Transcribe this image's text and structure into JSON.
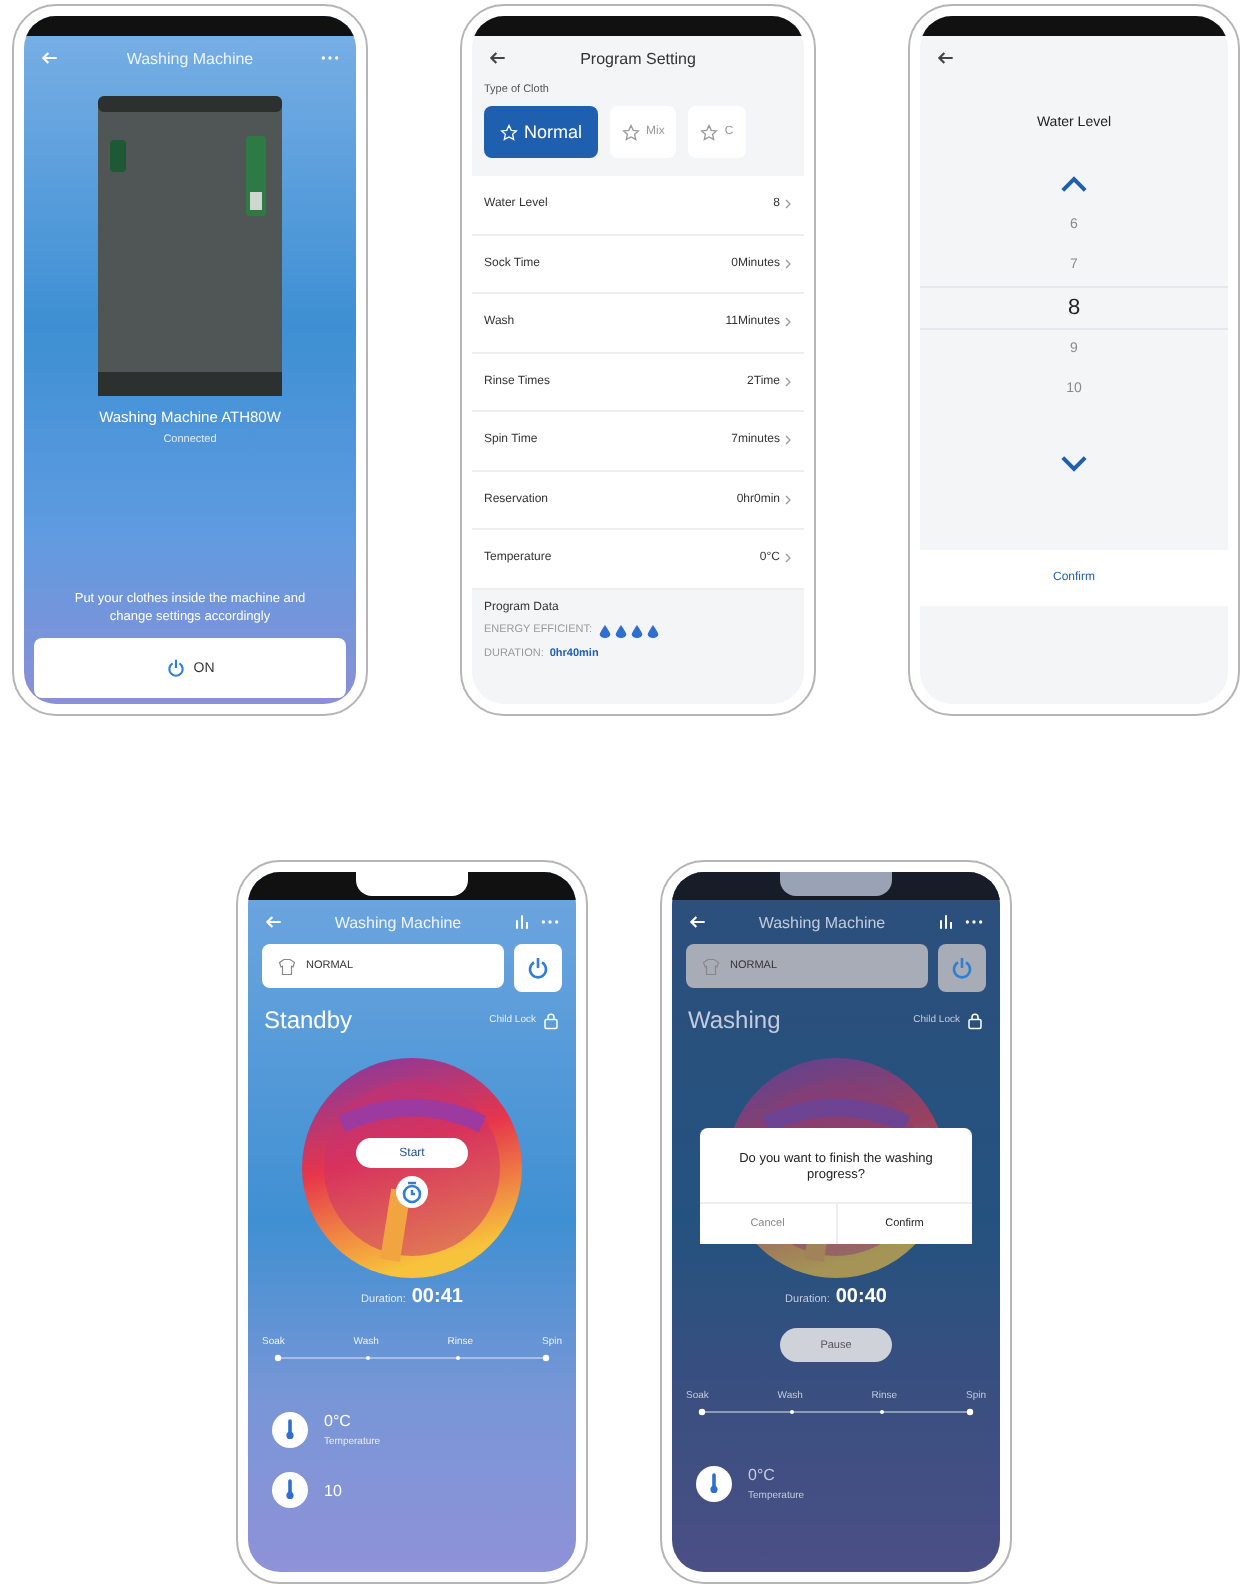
{
  "device_screen": {
    "title": "Washing Machine",
    "model": "Washing Machine ATH80W",
    "status": "Connected",
    "hint": "Put your clothes inside the machine and change settings accordingly",
    "power_button": "ON"
  },
  "program_screen": {
    "title": "Program Setting",
    "cloth_label": "Type of Cloth",
    "cloth_types": [
      {
        "label": "Normal",
        "selected": true
      },
      {
        "label": "Mix",
        "selected": false
      },
      {
        "label": "C",
        "selected": false
      }
    ],
    "settings": [
      {
        "name": "Water Level",
        "value": "8"
      },
      {
        "name": "Sock Time",
        "value": "0Minutes"
      },
      {
        "name": "Wash",
        "value": "11Minutes"
      },
      {
        "name": "Rinse Times",
        "value": "2Time"
      },
      {
        "name": "Spin Time",
        "value": "7minutes"
      },
      {
        "name": "Reservation",
        "value": "0hr0min"
      },
      {
        "name": "Temperature",
        "value": "0°C"
      }
    ],
    "data_heading": "Program Data",
    "energy_label": "ENERGY EFFICIENT:",
    "stars": 4,
    "duration_label": "DURATION:",
    "duration_value": "0hr40min"
  },
  "water_level_screen": {
    "title": "Water Level",
    "options": [
      {
        "label": "6",
        "selected": false
      },
      {
        "label": "7",
        "selected": false
      },
      {
        "label": "8",
        "selected": true
      },
      {
        "label": "9",
        "selected": false
      },
      {
        "label": "10",
        "selected": false
      }
    ],
    "confirm": "Confirm"
  },
  "standby_screen": {
    "title": "Washing Machine",
    "program": "NORMAL",
    "state": "Standby",
    "child_lock": "Child Lock",
    "start_button": "Start",
    "duration_label": "Duration:",
    "duration": "00:41",
    "stages": [
      "Soak",
      "Wash",
      "Rinse",
      "Spin"
    ],
    "readings": [
      {
        "value": "0°C",
        "label": "Temperature"
      },
      {
        "value": "10"
      }
    ]
  },
  "washing_screen": {
    "title": "Washing Machine",
    "program": "NORMAL",
    "state": "Washing",
    "child_lock": "Child Lock",
    "duration_label": "Duration:",
    "duration": "00:40",
    "pause_button": "Pause",
    "stages": [
      "Soak",
      "Wash",
      "Rinse",
      "Spin"
    ],
    "readings": [
      {
        "value": "0°C",
        "label": "Temperature"
      }
    ],
    "dialog": {
      "message": "Do you want to finish the washing progress?",
      "buttons": [
        "Cancel",
        "Confirm"
      ]
    }
  }
}
